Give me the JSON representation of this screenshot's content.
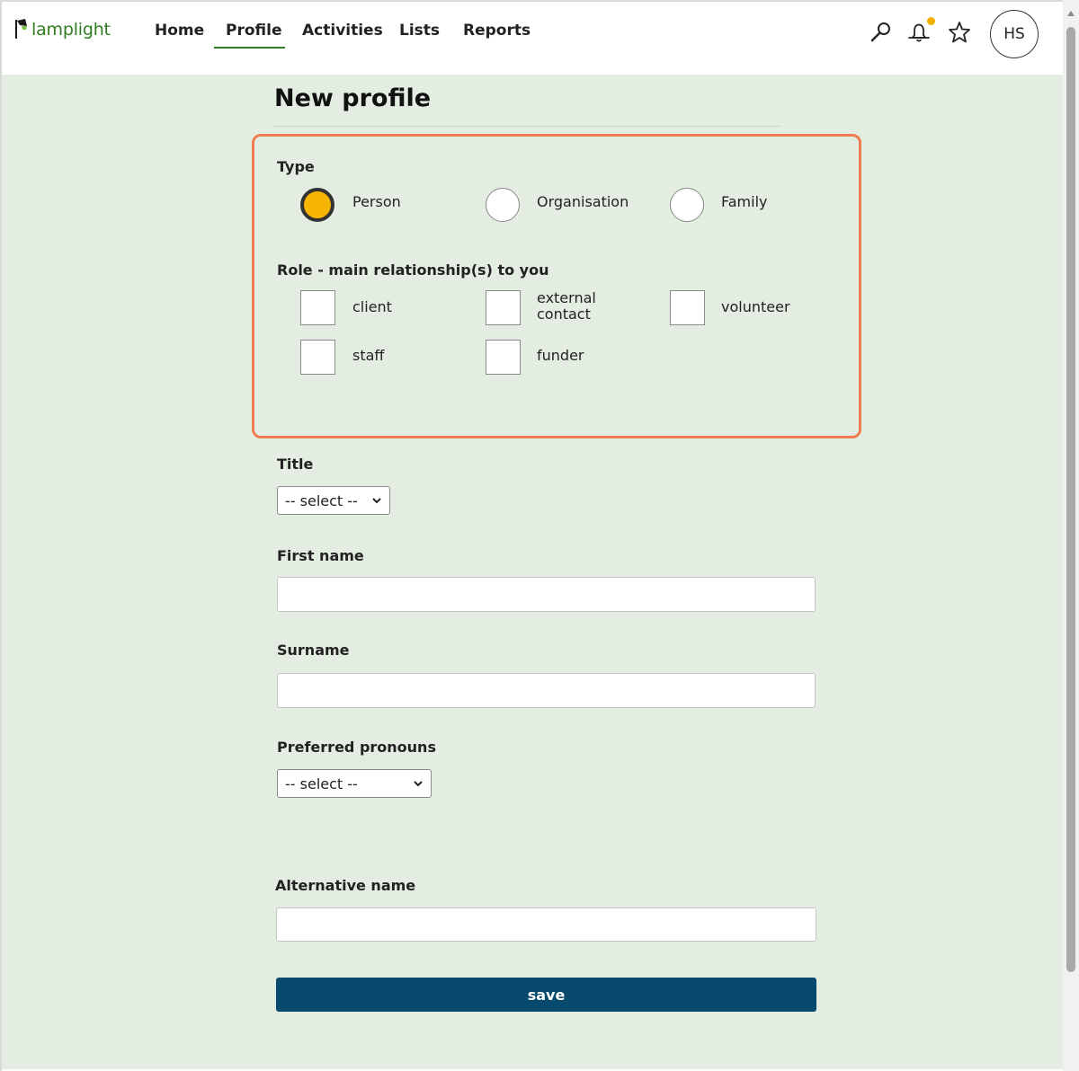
{
  "app": {
    "logo_text": "lamplight"
  },
  "nav": {
    "items": [
      {
        "label": "Home"
      },
      {
        "label": "Profile",
        "active": true
      },
      {
        "label": "Activities"
      },
      {
        "label": "Lists"
      },
      {
        "label": "Reports"
      }
    ]
  },
  "header": {
    "icons": [
      "search-icon",
      "bell-icon",
      "star-icon"
    ],
    "notification_dot": true,
    "avatar_initials": "HS"
  },
  "page": {
    "title": "New profile"
  },
  "type_section": {
    "label": "Type",
    "options": [
      {
        "label": "Person",
        "checked": true
      },
      {
        "label": "Organisation",
        "checked": false
      },
      {
        "label": "Family",
        "checked": false
      }
    ]
  },
  "role_section": {
    "label": "Role - main relationship(s) to you",
    "options": [
      {
        "label": "client",
        "checked": false
      },
      {
        "label": "external contact",
        "checked": false
      },
      {
        "label": "volunteer",
        "checked": false
      },
      {
        "label": "staff",
        "checked": false
      },
      {
        "label": "funder",
        "checked": false
      }
    ]
  },
  "fields": {
    "title": {
      "label": "Title",
      "value": "-- select --"
    },
    "first_name": {
      "label": "First name",
      "value": ""
    },
    "surname": {
      "label": "Surname",
      "value": ""
    },
    "pronouns": {
      "label": "Preferred pronouns",
      "value": "-- select --"
    },
    "alternative_name": {
      "label": "Alternative name",
      "value": ""
    }
  },
  "actions": {
    "save_label": "save"
  },
  "colors": {
    "brand_green": "#2e7d1f",
    "page_background": "#e4ede1",
    "highlight_border": "#f07c50",
    "radio_fill": "#f6b500",
    "save_button": "#074a6e",
    "notification_dot": "#f2b100"
  }
}
